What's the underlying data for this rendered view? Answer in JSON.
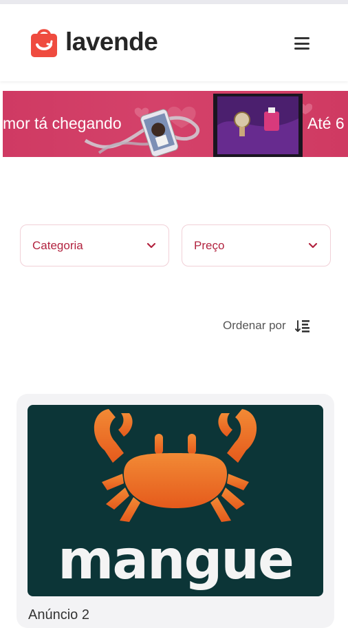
{
  "header": {
    "logo_text": "lavende",
    "brand_color": "#ef4b3f"
  },
  "banner": {
    "text_left": "mor tá chegando",
    "text_right": "Até 6",
    "background": "#d13d65"
  },
  "filters": [
    {
      "label": "Categoria"
    },
    {
      "label": "Preço"
    }
  ],
  "sort": {
    "label": "Ordenar por"
  },
  "listing": {
    "image_brand_text": "mangue",
    "title": "Anúncio 2"
  },
  "icons": {
    "logo": "shopping-bag-icon",
    "menu": "hamburger-menu-icon",
    "dropdown": "chevron-down-icon",
    "sort": "sort-descending-icon"
  }
}
